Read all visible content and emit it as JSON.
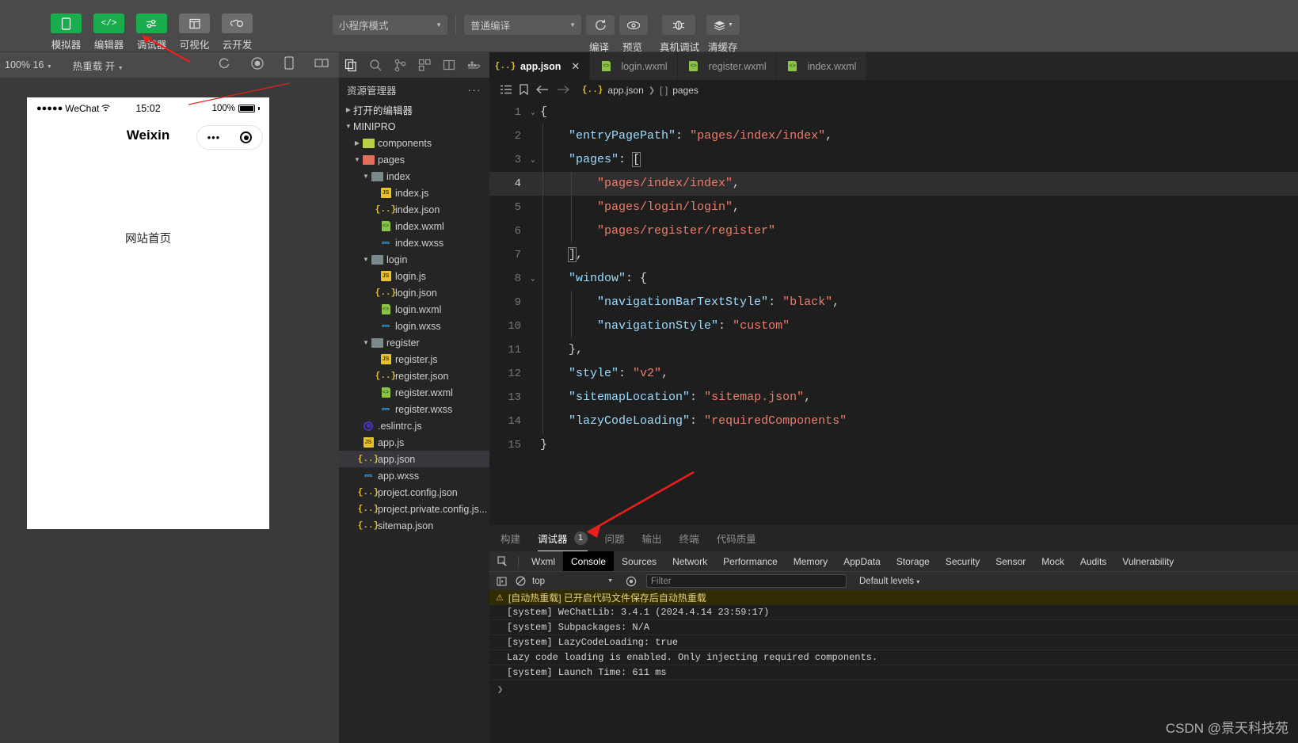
{
  "toolbar": {
    "left_items": [
      {
        "label": "模拟器",
        "icon": "phone-icon",
        "style": "green"
      },
      {
        "label": "编辑器",
        "icon": "code-icon",
        "style": "green"
      },
      {
        "label": "调试器",
        "icon": "sliders-icon",
        "style": "green"
      },
      {
        "label": "可视化",
        "icon": "layout-icon",
        "style": "grey"
      },
      {
        "label": "云开发",
        "icon": "cloud-icon",
        "style": "grey"
      }
    ],
    "mode_select": "小程序模式",
    "compile_select": "普通编译",
    "actions": [
      {
        "label": "编译",
        "icon": "refresh-icon"
      },
      {
        "label": "预览",
        "icon": "eye-icon"
      },
      {
        "label": "真机调试",
        "icon": "bug-icon"
      },
      {
        "label": "清缓存",
        "icon": "layers-icon"
      }
    ]
  },
  "subbar": {
    "zoom": "100% 16",
    "hotreload_label": "热重载",
    "hotreload_value": "开",
    "icons": [
      "refresh-circle-icon",
      "record-icon",
      "device-icon",
      "rotate-icon"
    ]
  },
  "simulator": {
    "carrier": "WeChat",
    "signal_dots": "●●●●●",
    "wifi_icon": "wifi-icon",
    "time": "15:02",
    "battery_pct": "100%",
    "nav_title": "Weixin",
    "capsule_more": "•••",
    "capsule_target": "target-icon",
    "page_text": "网站首页"
  },
  "explorer": {
    "strip_icons": [
      "files-icon",
      "search-icon",
      "source-control-icon",
      "extensions-icon",
      "split-editor-icon",
      "docker-icon"
    ],
    "title": "资源管理器",
    "more": "···",
    "tree": [
      {
        "depth": 0,
        "arrow": "right",
        "icon": "none",
        "label": "打开的编辑器",
        "head": true
      },
      {
        "depth": 0,
        "arrow": "down",
        "icon": "none",
        "label": "MINIPRO",
        "head": true
      },
      {
        "depth": 1,
        "arrow": "right",
        "icon": "folder-lime",
        "label": "components"
      },
      {
        "depth": 1,
        "arrow": "down",
        "icon": "folder-salmon",
        "label": "pages"
      },
      {
        "depth": 2,
        "arrow": "down",
        "icon": "folder-teal",
        "label": "index"
      },
      {
        "depth": 3,
        "arrow": "blank",
        "icon": "js",
        "label": "index.js"
      },
      {
        "depth": 3,
        "arrow": "blank",
        "icon": "json",
        "label": "index.json"
      },
      {
        "depth": 3,
        "arrow": "blank",
        "icon": "wxml",
        "label": "index.wxml"
      },
      {
        "depth": 3,
        "arrow": "blank",
        "icon": "wxss",
        "label": "index.wxss"
      },
      {
        "depth": 2,
        "arrow": "down",
        "icon": "folder-teal",
        "label": "login"
      },
      {
        "depth": 3,
        "arrow": "blank",
        "icon": "js",
        "label": "login.js"
      },
      {
        "depth": 3,
        "arrow": "blank",
        "icon": "json",
        "label": "login.json"
      },
      {
        "depth": 3,
        "arrow": "blank",
        "icon": "wxml",
        "label": "login.wxml"
      },
      {
        "depth": 3,
        "arrow": "blank",
        "icon": "wxss",
        "label": "login.wxss"
      },
      {
        "depth": 2,
        "arrow": "down",
        "icon": "folder-teal",
        "label": "register"
      },
      {
        "depth": 3,
        "arrow": "blank",
        "icon": "js",
        "label": "register.js"
      },
      {
        "depth": 3,
        "arrow": "blank",
        "icon": "json",
        "label": "register.json"
      },
      {
        "depth": 3,
        "arrow": "blank",
        "icon": "wxml",
        "label": "register.wxml"
      },
      {
        "depth": 3,
        "arrow": "blank",
        "icon": "wxss",
        "label": "register.wxss"
      },
      {
        "depth": 1,
        "arrow": "blank",
        "icon": "eslint",
        "label": ".eslintrc.js"
      },
      {
        "depth": 1,
        "arrow": "blank",
        "icon": "js",
        "label": "app.js"
      },
      {
        "depth": 1,
        "arrow": "blank",
        "icon": "json",
        "label": "app.json",
        "selected": true
      },
      {
        "depth": 1,
        "arrow": "blank",
        "icon": "wxss",
        "label": "app.wxss"
      },
      {
        "depth": 1,
        "arrow": "blank",
        "icon": "json",
        "label": "project.config.json"
      },
      {
        "depth": 1,
        "arrow": "blank",
        "icon": "json",
        "label": "project.private.config.js..."
      },
      {
        "depth": 1,
        "arrow": "blank",
        "icon": "json",
        "label": "sitemap.json"
      }
    ]
  },
  "editor": {
    "tabs": [
      {
        "label": "app.json",
        "icon": "json",
        "active": true,
        "close": "✕"
      },
      {
        "label": "login.wxml",
        "icon": "wxml",
        "active": false
      },
      {
        "label": "register.wxml",
        "icon": "wxml",
        "active": false
      },
      {
        "label": "index.wxml",
        "icon": "wxml",
        "active": false
      }
    ],
    "breadcrumb_icons": [
      "outline-icon",
      "bookmark-icon",
      "arrow-left-icon",
      "arrow-right-icon"
    ],
    "breadcrumb": {
      "file_icon": "json",
      "file": "app.json",
      "sep": "❯",
      "bracket": "[ ]",
      "node": "pages"
    },
    "current_line": 4,
    "code_lines": [
      {
        "n": 1,
        "fold": "down",
        "indent": 0,
        "tokens": [
          {
            "t": "br",
            "v": "{"
          }
        ]
      },
      {
        "n": 2,
        "fold": "",
        "indent": 1,
        "tokens": [
          {
            "t": "key",
            "v": "\"entryPagePath\""
          },
          {
            "t": "pun",
            "v": ": "
          },
          {
            "t": "str",
            "v": "\"pages/index/index\""
          },
          {
            "t": "pun",
            "v": ","
          }
        ]
      },
      {
        "n": 3,
        "fold": "down",
        "indent": 1,
        "tokens": [
          {
            "t": "key",
            "v": "\"pages\""
          },
          {
            "t": "pun",
            "v": ": "
          },
          {
            "t": "brm",
            "v": "["
          }
        ]
      },
      {
        "n": 4,
        "fold": "",
        "indent": 2,
        "tokens": [
          {
            "t": "str",
            "v": "\"pages/index/index\""
          },
          {
            "t": "pun",
            "v": ","
          }
        ]
      },
      {
        "n": 5,
        "fold": "",
        "indent": 2,
        "tokens": [
          {
            "t": "str",
            "v": "\"pages/login/login\""
          },
          {
            "t": "pun",
            "v": ","
          }
        ]
      },
      {
        "n": 6,
        "fold": "",
        "indent": 2,
        "tokens": [
          {
            "t": "str",
            "v": "\"pages/register/register\""
          }
        ]
      },
      {
        "n": 7,
        "fold": "",
        "indent": 1,
        "tokens": [
          {
            "t": "brm",
            "v": "]"
          },
          {
            "t": "pun",
            "v": ","
          }
        ]
      },
      {
        "n": 8,
        "fold": "down",
        "indent": 1,
        "tokens": [
          {
            "t": "key",
            "v": "\"window\""
          },
          {
            "t": "pun",
            "v": ": "
          },
          {
            "t": "br",
            "v": "{"
          }
        ]
      },
      {
        "n": 9,
        "fold": "",
        "indent": 2,
        "tokens": [
          {
            "t": "key",
            "v": "\"navigationBarTextStyle\""
          },
          {
            "t": "pun",
            "v": ": "
          },
          {
            "t": "str",
            "v": "\"black\""
          },
          {
            "t": "pun",
            "v": ","
          }
        ]
      },
      {
        "n": 10,
        "fold": "",
        "indent": 2,
        "tokens": [
          {
            "t": "key",
            "v": "\"navigationStyle\""
          },
          {
            "t": "pun",
            "v": ": "
          },
          {
            "t": "str",
            "v": "\"custom\""
          }
        ]
      },
      {
        "n": 11,
        "fold": "",
        "indent": 1,
        "tokens": [
          {
            "t": "br",
            "v": "}"
          },
          {
            "t": "pun",
            "v": ","
          }
        ]
      },
      {
        "n": 12,
        "fold": "",
        "indent": 1,
        "tokens": [
          {
            "t": "key",
            "v": "\"style\""
          },
          {
            "t": "pun",
            "v": ": "
          },
          {
            "t": "str",
            "v": "\"v2\""
          },
          {
            "t": "pun",
            "v": ","
          }
        ]
      },
      {
        "n": 13,
        "fold": "",
        "indent": 1,
        "tokens": [
          {
            "t": "key",
            "v": "\"sitemapLocation\""
          },
          {
            "t": "pun",
            "v": ": "
          },
          {
            "t": "str",
            "v": "\"sitemap.json\""
          },
          {
            "t": "pun",
            "v": ","
          }
        ]
      },
      {
        "n": 14,
        "fold": "",
        "indent": 1,
        "tokens": [
          {
            "t": "key",
            "v": "\"lazyCodeLoading\""
          },
          {
            "t": "pun",
            "v": ": "
          },
          {
            "t": "str",
            "v": "\"requiredComponents\""
          }
        ]
      },
      {
        "n": 15,
        "fold": "",
        "indent": 0,
        "tokens": [
          {
            "t": "br",
            "v": "}"
          }
        ]
      }
    ]
  },
  "panel": {
    "tabs": [
      {
        "label": "构建",
        "active": false
      },
      {
        "label": "调试器",
        "active": true,
        "badge": "1"
      },
      {
        "label": "问题",
        "active": false
      },
      {
        "label": "输出",
        "active": false
      },
      {
        "label": "终端",
        "active": false
      },
      {
        "label": "代码质量",
        "active": false
      }
    ],
    "devtools_tabs": [
      {
        "label": "Wxml",
        "active": false
      },
      {
        "label": "Console",
        "active": true
      },
      {
        "label": "Sources",
        "active": false
      },
      {
        "label": "Network",
        "active": false
      },
      {
        "label": "Performance",
        "active": false
      },
      {
        "label": "Memory",
        "active": false
      },
      {
        "label": "AppData",
        "active": false
      },
      {
        "label": "Storage",
        "active": false
      },
      {
        "label": "Security",
        "active": false
      },
      {
        "label": "Sensor",
        "active": false
      },
      {
        "label": "Mock",
        "active": false
      },
      {
        "label": "Audits",
        "active": false
      },
      {
        "label": "Vulnerability",
        "active": false
      }
    ],
    "inspect_icon": "inspect-icon",
    "console_ctrl": {
      "sidebar_icon": "console-sidebar-icon",
      "clear_icon": "clear-console-icon",
      "context": "top",
      "eye_icon": "live-expression-icon",
      "filter_placeholder": "Filter",
      "levels": "Default levels",
      "levels_caret": "▾"
    },
    "logs": [
      {
        "kind": "warn",
        "icon": "warning-icon",
        "text": "[自动热重载] 已开启代码文件保存后自动热重载"
      },
      {
        "kind": "normal",
        "text": "[system] WeChatLib: 3.4.1 (2024.4.14 23:59:17)"
      },
      {
        "kind": "normal",
        "text": "[system] Subpackages: N/A"
      },
      {
        "kind": "normal",
        "text": "[system] LazyCodeLoading: true"
      },
      {
        "kind": "normal",
        "text": "Lazy code loading is enabled. Only injecting required components."
      },
      {
        "kind": "normal",
        "text": "[system] Launch Time: 611 ms"
      }
    ],
    "prompt": "❯"
  },
  "watermark": "CSDN @景天科技苑",
  "colors": {
    "accent_green": "#1aad4e",
    "toolbar_bg": "#4a4a4a",
    "editor_bg": "#1e1e1e",
    "explorer_bg": "#252526",
    "string_token": "#f07c6a",
    "key_token": "#9cdcfe",
    "annotation_arrow": "#e8201b"
  }
}
